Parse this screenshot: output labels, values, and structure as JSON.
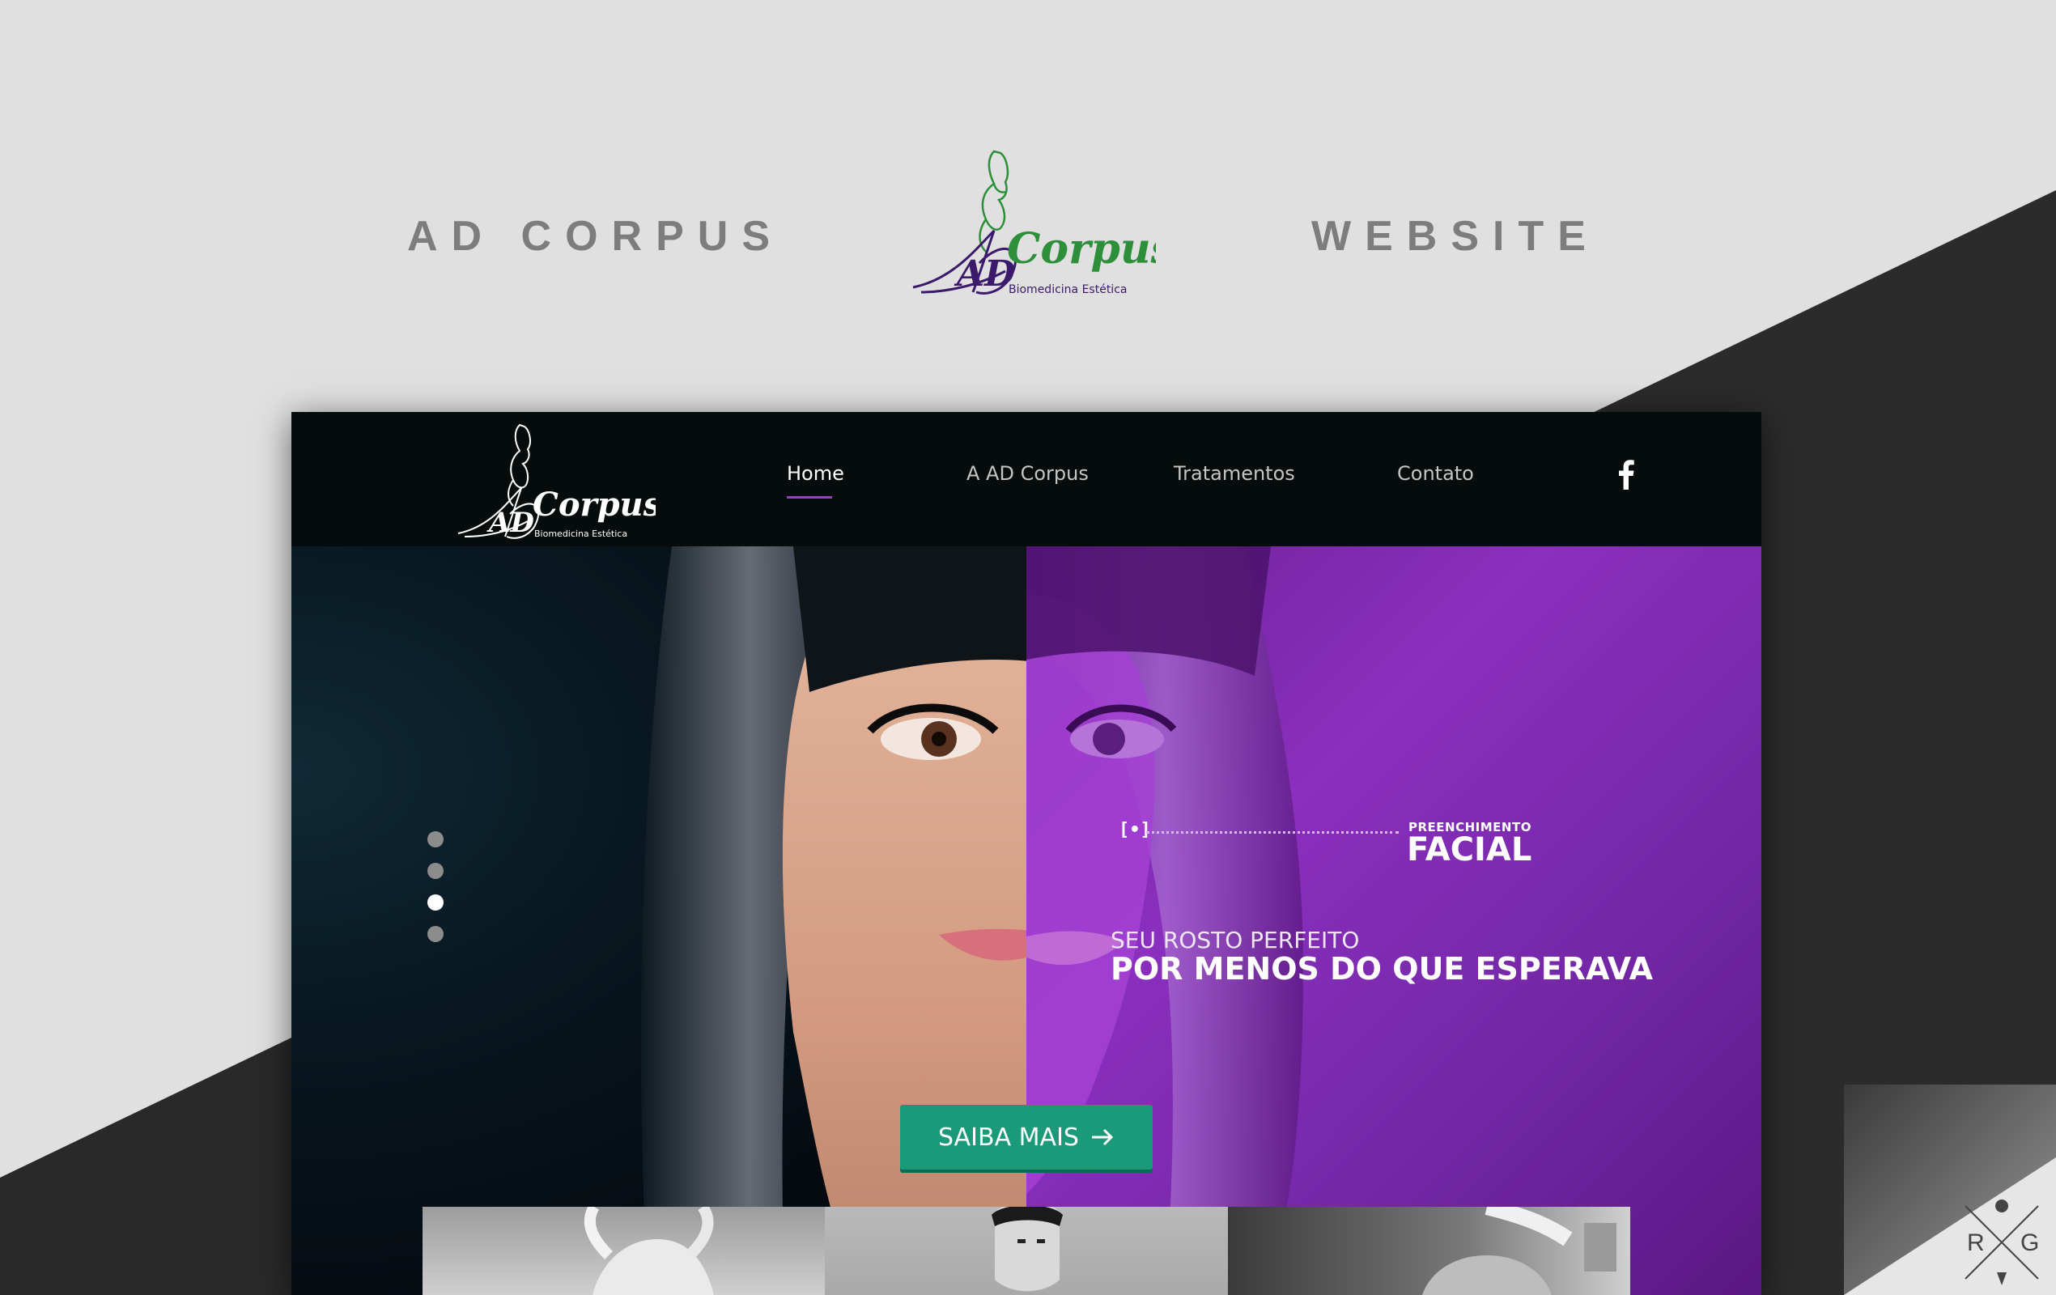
{
  "header": {
    "left_title": "AD CORPUS",
    "right_title": "WEBSITE",
    "logo": {
      "wordmark": "Corpus",
      "monogram": "AD",
      "tagline": "Biomedicina Estética"
    }
  },
  "site": {
    "nav": {
      "logo": {
        "wordmark": "Corpus",
        "monogram": "AD",
        "tagline": "Biomedicina Estética"
      },
      "items": [
        {
          "label": "Home",
          "active": true
        },
        {
          "label": "A AD Corpus",
          "active": false
        },
        {
          "label": "Tratamentos",
          "active": false
        },
        {
          "label": "Contato",
          "active": false
        }
      ],
      "social_icon": "facebook-icon"
    },
    "hero": {
      "marker": "[•]",
      "kicker": "PREENCHIMENTO",
      "title": "FACIAL",
      "subline": "SEU ROSTO PERFEITO",
      "headline": "POR MENOS DO QUE ESPERAVA",
      "cta_label": "SAIBA MAIS",
      "cta_icon": "arrow-right-icon",
      "slider": {
        "count": 4,
        "active_index": 2
      }
    }
  },
  "badge": {
    "left": "R",
    "right": "G"
  },
  "colors": {
    "accent_purple": "#8a2fbf",
    "cta_green": "#1b9a79",
    "nav_bg": "#060b0b",
    "page_bg": "#e0e0e0",
    "logo_green": "#2e8f3a",
    "logo_purple": "#3b1a6b"
  }
}
